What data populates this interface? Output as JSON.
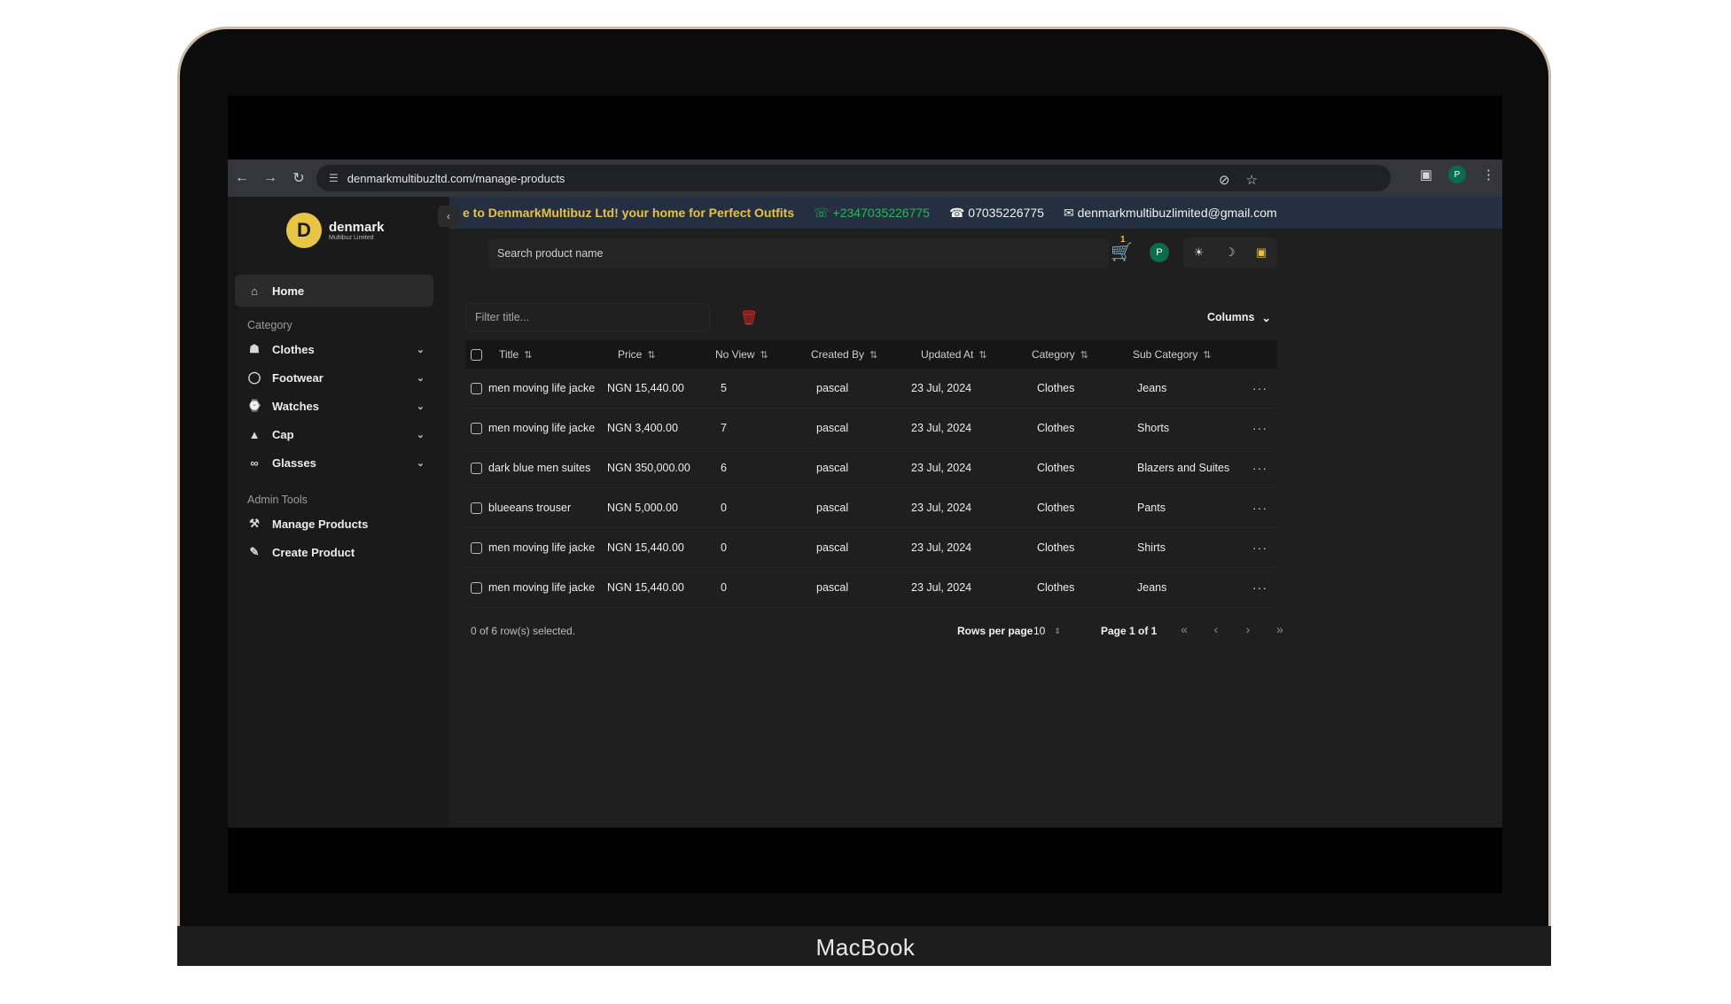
{
  "device": {
    "brand": "MacBook"
  },
  "browser": {
    "url": "denmarkmultibuzltd.com/manage-products",
    "profile_initial": "P"
  },
  "sidebar": {
    "logo_name": "denmark",
    "logo_tagline": "Multibuz Limited",
    "home_label": "Home",
    "category_label": "Category",
    "categories": [
      "Clothes",
      "Footwear",
      "Watches",
      "Cap",
      "Glasses"
    ],
    "admin_label": "Admin Tools",
    "admin_items": [
      "Manage Products",
      "Create Product"
    ]
  },
  "marquee": {
    "welcome": "e to DenmarkMultibuz Ltd! your home for Perfect Outfits",
    "whatsapp": "+2347035226775",
    "phone": "07035226775",
    "email": "denmarkmultibuzlimited@gmail.com"
  },
  "topbar": {
    "search_placeholder": "Search product name",
    "cart_count": "1",
    "user_initial": "P"
  },
  "toolbar": {
    "filter_placeholder": "Filter title...",
    "columns_label": "Columns"
  },
  "table": {
    "headers": [
      "Title",
      "Price",
      "No View",
      "Created By",
      "Updated At",
      "Category",
      "Sub Category"
    ],
    "rows": [
      [
        "men moving life jacke",
        "NGN 15,440.00",
        "5",
        "pascal",
        "23 Jul, 2024",
        "Clothes",
        "Jeans"
      ],
      [
        "men moving life jacke",
        "NGN 3,400.00",
        "7",
        "pascal",
        "23 Jul, 2024",
        "Clothes",
        "Shorts"
      ],
      [
        "dark blue men suites",
        "NGN 350,000.00",
        "6",
        "pascal",
        "23 Jul, 2024",
        "Clothes",
        "Blazers and Suites"
      ],
      [
        "blueeans trouser",
        "NGN 5,000.00",
        "0",
        "pascal",
        "23 Jul, 2024",
        "Clothes",
        "Pants"
      ],
      [
        "men moving life jacke",
        "NGN 15,440.00",
        "0",
        "pascal",
        "23 Jul, 2024",
        "Clothes",
        "Shirts"
      ],
      [
        "men moving life jacke",
        "NGN 15,440.00",
        "0",
        "pascal",
        "23 Jul, 2024",
        "Clothes",
        "Jeans"
      ]
    ]
  },
  "footer": {
    "selection": "0 of 6 row(s) selected.",
    "rows_per_page_label": "Rows per page",
    "rows_per_page_value": "10",
    "page_info": "Page 1 of 1"
  },
  "colors": {
    "accent": "#e7c246",
    "whatsapp": "#27b857",
    "danger": "#d92626",
    "background": "#1f1f1f"
  }
}
